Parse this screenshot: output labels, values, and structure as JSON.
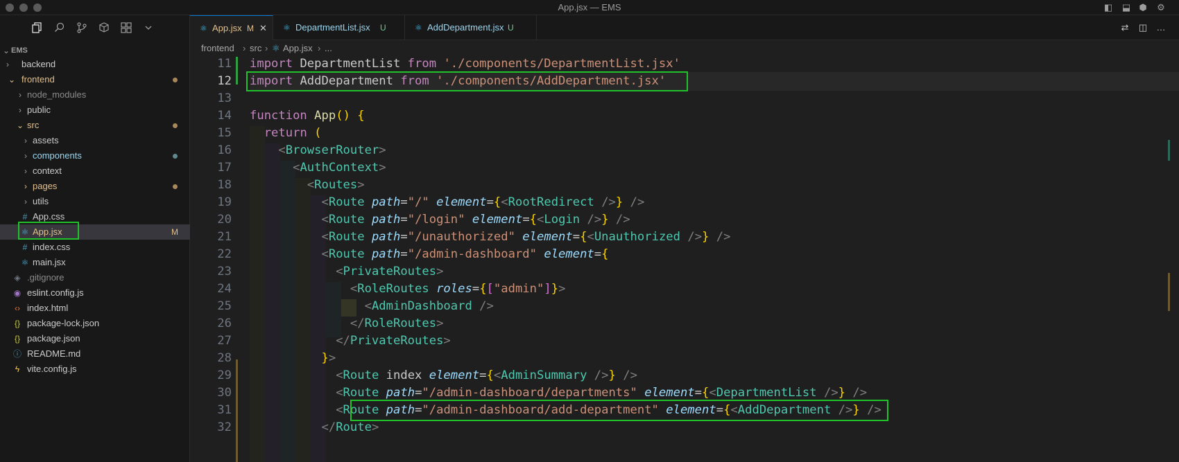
{
  "window": {
    "title": "App.jsx — EMS"
  },
  "icons": {
    "explorer": "files-icon",
    "search": "search-icon",
    "source_control": "source-control-icon",
    "extensions": "extensions-icon",
    "remote": "remote-icon",
    "more": "chevron-down-icon"
  },
  "explorer": {
    "root_label": "EMS",
    "items": [
      {
        "label": "backend",
        "kind": "folder",
        "open": false
      },
      {
        "label": "frontend",
        "kind": "folder",
        "open": true,
        "modified_dot": true
      },
      {
        "label": "node_modules",
        "kind": "folder",
        "open": false
      },
      {
        "label": "public",
        "kind": "folder",
        "open": false
      },
      {
        "label": "src",
        "kind": "folder",
        "open": true,
        "modified_dot": true
      },
      {
        "label": "assets",
        "kind": "folder",
        "open": false
      },
      {
        "label": "components",
        "kind": "folder",
        "open": false,
        "untracked_dot": true
      },
      {
        "label": "context",
        "kind": "folder",
        "open": false
      },
      {
        "label": "pages",
        "kind": "folder",
        "open": false,
        "modified_dot": true
      },
      {
        "label": "utils",
        "kind": "folder",
        "open": false
      },
      {
        "label": "App.css",
        "kind": "css"
      },
      {
        "label": "App.jsx",
        "kind": "react",
        "badge": "M",
        "selected": true
      },
      {
        "label": "index.css",
        "kind": "css"
      },
      {
        "label": "main.jsx",
        "kind": "react"
      },
      {
        "label": ".gitignore",
        "kind": "git"
      },
      {
        "label": "eslint.config.js",
        "kind": "eslint"
      },
      {
        "label": "index.html",
        "kind": "html"
      },
      {
        "label": "package-lock.json",
        "kind": "json"
      },
      {
        "label": "package.json",
        "kind": "json"
      },
      {
        "label": "README.md",
        "kind": "info"
      },
      {
        "label": "vite.config.js",
        "kind": "vite"
      }
    ]
  },
  "tabs": [
    {
      "name": "App.jsx",
      "status": "M",
      "active": true
    },
    {
      "name": "DepartmentList.jsx",
      "status": "U",
      "active": false
    },
    {
      "name": "AddDepartment.jsx",
      "status": "U",
      "active": false
    }
  ],
  "breadcrumb": {
    "parts": [
      "frontend",
      "src",
      "App.jsx",
      "..."
    ]
  },
  "editor": {
    "current_line": 12,
    "line_numbers": [
      "11",
      "12",
      "13",
      "14",
      "15",
      "16",
      "17",
      "18",
      "19",
      "20",
      "21",
      "22",
      "23",
      "24",
      "25",
      "26",
      "27",
      "28",
      "29",
      "30",
      "31",
      "32"
    ],
    "lines": [
      "import DepartmentList from './components/DepartmentList.jsx'",
      "import AddDepartment from './components/AddDepartment.jsx'",
      "",
      "function App() {",
      "  return (",
      "    <BrowserRouter>",
      "      <AuthContext>",
      "        <Routes>",
      "          <Route path=\"/\" element={<RootRedirect />} />",
      "          <Route path=\"/login\" element={<Login />} />",
      "          <Route path=\"/unauthorized\" element={<Unauthorized />} />",
      "          <Route path=\"/admin-dashboard\" element={",
      "            <PrivateRoutes>",
      "              <RoleRoutes roles={[\"admin\"]}>",
      "                <AdminDashboard />",
      "              </RoleRoutes>",
      "            </PrivateRoutes>",
      "          }>",
      "            <Route index element={<AdminSummary />} />",
      "            <Route path=\"/admin-dashboard/departments\" element={<DepartmentList />} />",
      "            <Route path=\"/admin-dashboard/add-department\" element={<AddDepartment />} />",
      "          </Route>"
    ]
  },
  "colors": {
    "highlight_box": "#22c22a",
    "modified": "#d29922",
    "untracked": "#73c991",
    "folder_modified": "#e2c08d",
    "accent": "#0078d4"
  }
}
